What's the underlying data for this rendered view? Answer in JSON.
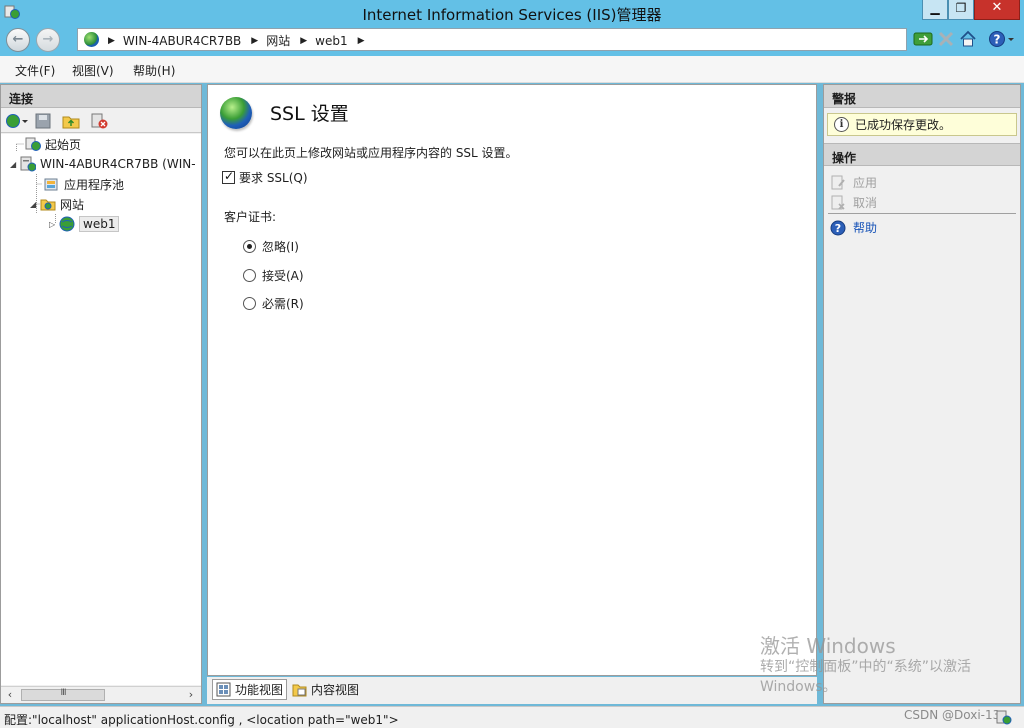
{
  "window": {
    "title": "Internet Information Services (IIS)管理器",
    "min_glyph": "▁",
    "max_glyph": "❐",
    "close_glyph": "✕"
  },
  "address": {
    "crumbs": [
      "WIN-4ABUR4CR7BB",
      "网站",
      "web1"
    ],
    "crumb_arrow": "▶"
  },
  "menu": {
    "file": "文件(F)",
    "view": "视图(V)",
    "help": "帮助(H)"
  },
  "connections": {
    "header": "连接",
    "tree": {
      "start_page": "起始页",
      "server": "WIN-4ABUR4CR7BB (WIN-",
      "app_pools": "应用程序池",
      "sites": "网站",
      "site_web1": "web1"
    },
    "scroll_grip": "III"
  },
  "main": {
    "title": "SSL 设置",
    "description": "您可以在此页上修改网站或应用程序内容的 SSL 设置。",
    "require_ssl": {
      "label": "要求 SSL(Q)",
      "checked": true
    },
    "client_cert_label": "客户证书:",
    "client_cert_options": [
      {
        "label": "忽略(I)",
        "selected": true
      },
      {
        "label": "接受(A)",
        "selected": false
      },
      {
        "label": "必需(R)",
        "selected": false
      }
    ]
  },
  "view_tabs": {
    "features": "功能视图",
    "content": "内容视图"
  },
  "alerts": {
    "header": "警报",
    "message": "已成功保存更改。"
  },
  "actions": {
    "header": "操作",
    "apply": "应用",
    "cancel": "取消",
    "help": "帮助"
  },
  "watermark": {
    "line1": "激活 Windows",
    "line2": "转到“控制面板”中的“系统”以激活",
    "line3": "Windows。"
  },
  "status": {
    "text": "配置:\"localhost\" applicationHost.config , <location path=\"web1\">",
    "credit": "CSDN @Doxi-13"
  },
  "colors": {
    "title_bar": "#63c0e6",
    "close_button": "#c7322b",
    "link": "#1a55b8"
  }
}
